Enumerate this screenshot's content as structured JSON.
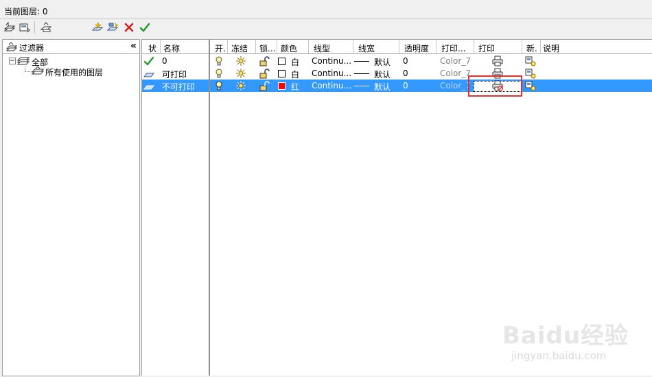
{
  "status": {
    "current_layer_label": "当前图层: 0"
  },
  "toolbar": {
    "left_icons": [
      "new-filter-icon",
      "layer-states-icon",
      "filter-icon"
    ],
    "right_icons": [
      "new-layer-icon",
      "new-layer-vp-frozen-icon",
      "delete-layer-icon",
      "set-current-icon"
    ]
  },
  "filter_panel": {
    "title": "过滤器",
    "collapse_glyph": "«",
    "tree": {
      "root_label": "全部",
      "root_toggle": "−",
      "child_label": "所有使用的图层"
    }
  },
  "layer_table": {
    "columns": [
      "状",
      "名称",
      "开.",
      "冻结",
      "锁...",
      "颜色",
      "线型",
      "线宽",
      "透明度",
      "打印...",
      "打印",
      "新.",
      "说明"
    ],
    "rows": [
      {
        "name": "0",
        "status": "current",
        "color_name": "白",
        "color_hex": "#ffffff",
        "linetype": "Continu...",
        "lineweight": "默认",
        "transparency": "0",
        "plot_style": "Color_7",
        "plot": "printable",
        "selected": false
      },
      {
        "name": "可打印",
        "status": "layer",
        "color_name": "白",
        "color_hex": "#ffffff",
        "linetype": "Continu...",
        "lineweight": "默认",
        "transparency": "0",
        "plot_style": "Color_7",
        "plot": "printable",
        "selected": false
      },
      {
        "name": "不可打印",
        "status": "layer",
        "color_name": "红",
        "color_hex": "#ff0000",
        "linetype": "Continu...",
        "lineweight": "默认",
        "transparency": "0",
        "plot_style": "Color_7",
        "plot": "no-plot",
        "selected": true
      }
    ]
  },
  "watermark": {
    "logo": "Baidu经验",
    "url": "jingyan.baidu.com"
  },
  "accent": {
    "selection": "#3399ff",
    "highlight": "#e03030"
  }
}
